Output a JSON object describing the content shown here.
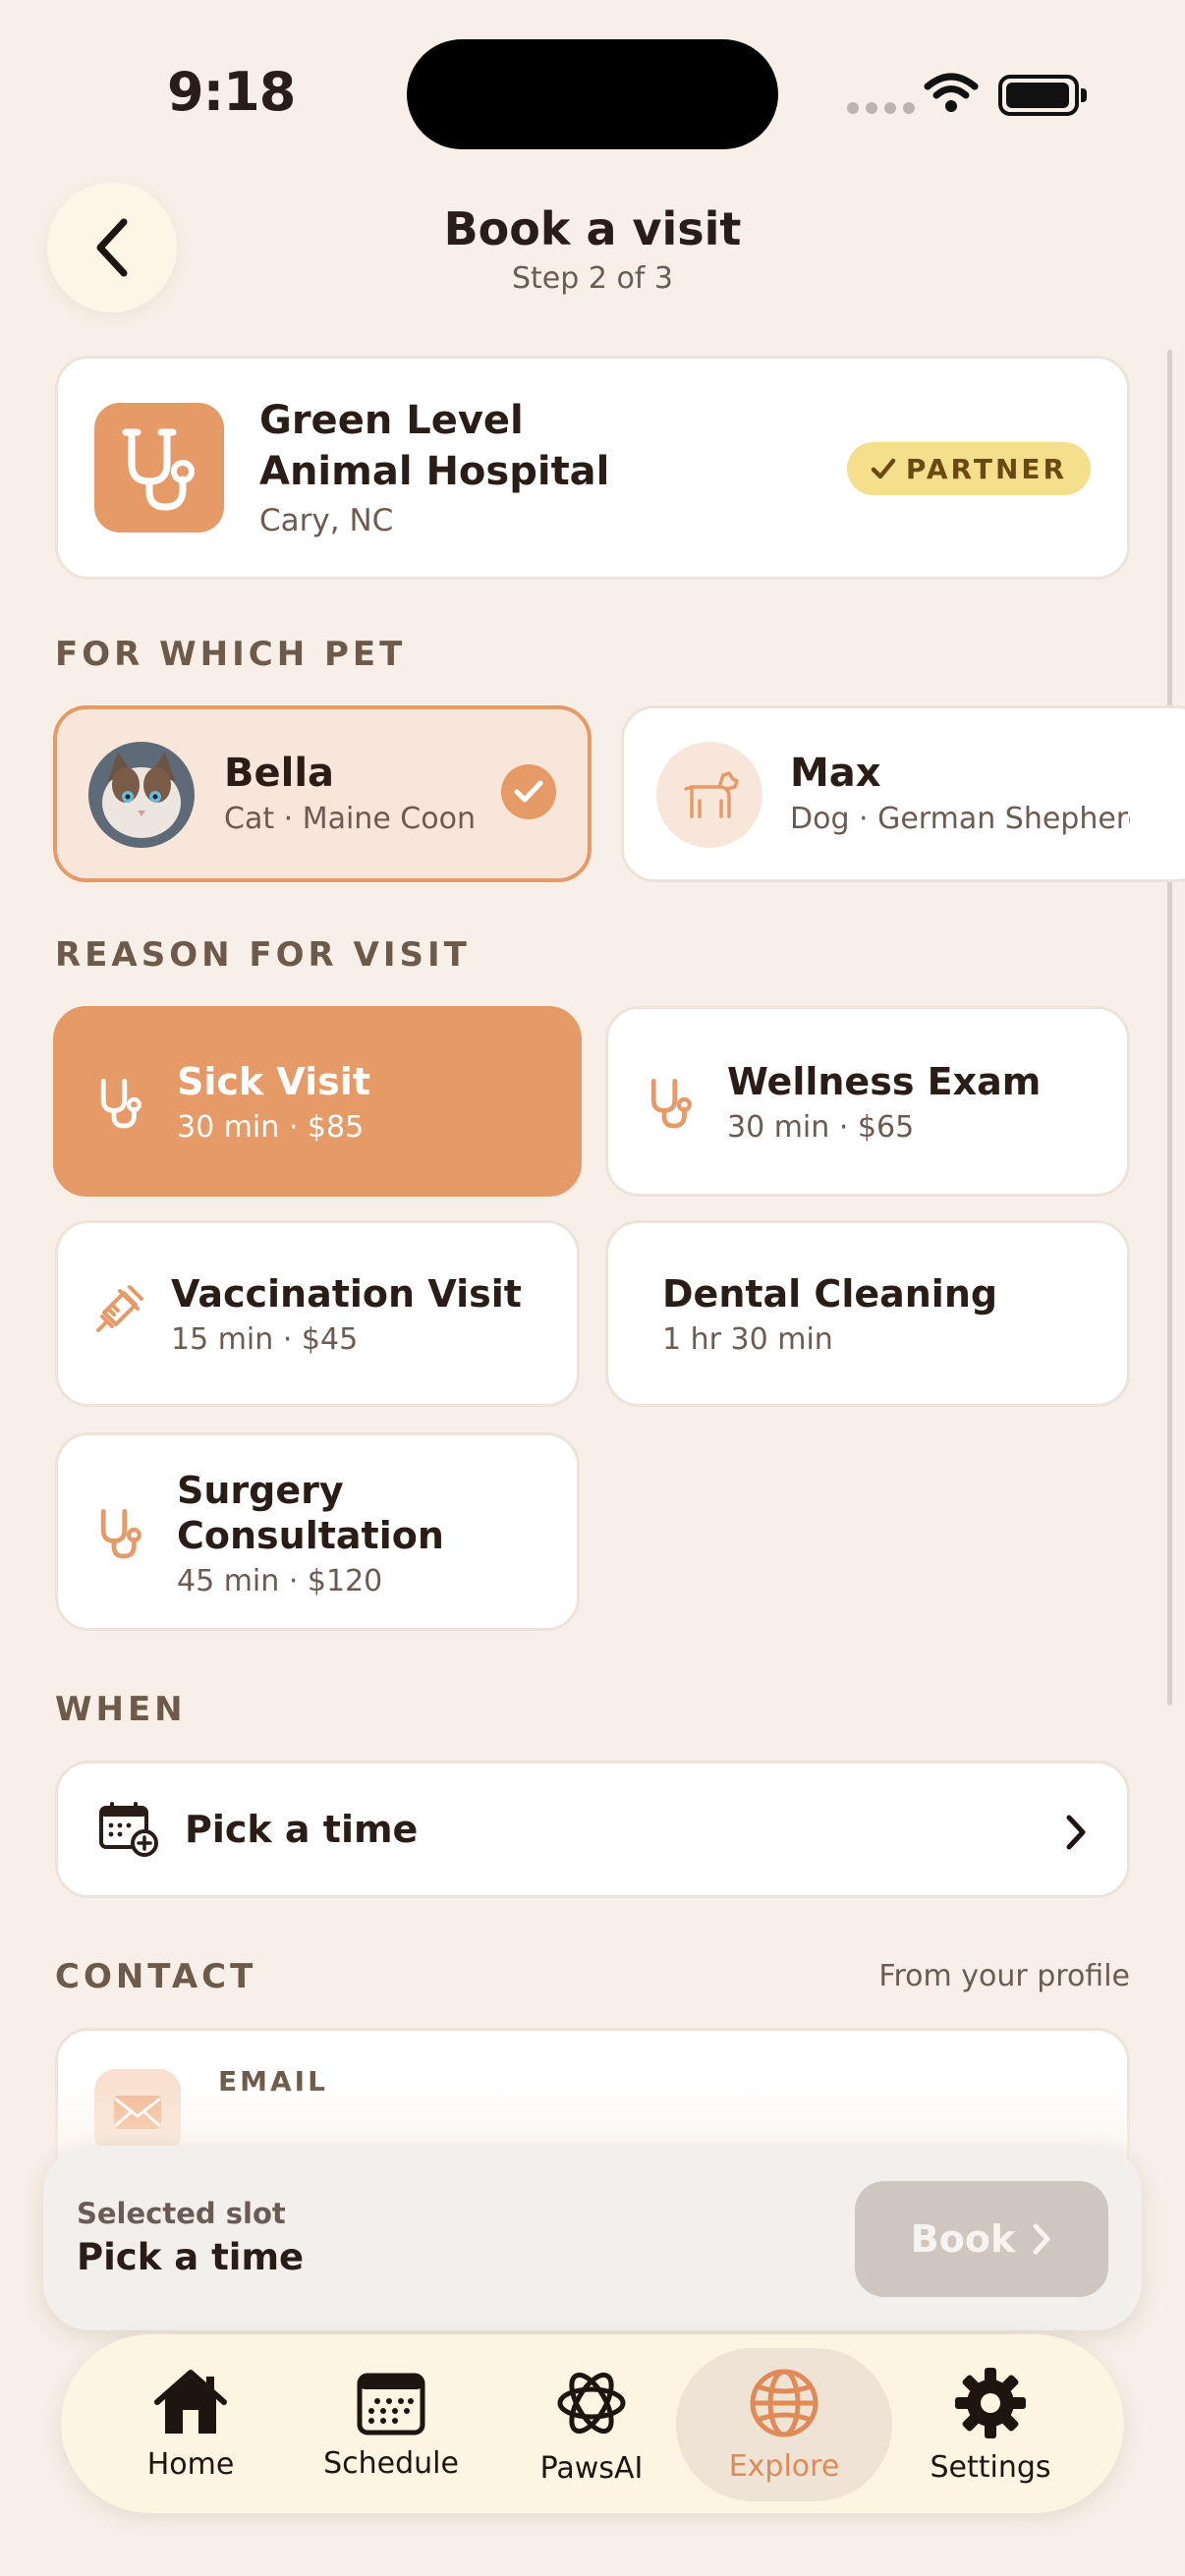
{
  "status_bar": {
    "time": "9:18"
  },
  "header": {
    "title": "Book a visit",
    "step": "Step 2 of 3"
  },
  "clinic": {
    "name": "Green Level Animal Hospital",
    "location": "Cary, NC",
    "badge": "PARTNER"
  },
  "pets": {
    "section_label": "FOR WHICH PET",
    "items": [
      {
        "name": "Bella",
        "description": "Cat · Maine Coon",
        "selected": true
      },
      {
        "name": "Max",
        "description": "Dog · German Shepherd",
        "selected": false
      }
    ]
  },
  "reasons": {
    "section_label": "REASON FOR VISIT",
    "items": [
      {
        "title": "Sick Visit",
        "detail": "30 min · $85",
        "icon": "stethoscope-icon",
        "selected": true
      },
      {
        "title": "Wellness Exam",
        "detail": "30 min · $65",
        "icon": "stethoscope-icon",
        "selected": false
      },
      {
        "title": "Vaccination Visit",
        "detail": "15 min · $45",
        "icon": "syringe-icon",
        "selected": false
      },
      {
        "title": "Dental Cleaning",
        "detail": "1 hr 30 min",
        "icon": "",
        "selected": false
      },
      {
        "title": "Surgery Consultation",
        "detail": "45 min · $120",
        "icon": "stethoscope-icon",
        "selected": false
      }
    ]
  },
  "when": {
    "section_label": "WHEN",
    "pick_label": "Pick a time"
  },
  "contact": {
    "section_label": "CONTACT",
    "note": "From your profile",
    "email_label": "EMAIL"
  },
  "booking_bar": {
    "caption": "Selected slot",
    "value": "Pick a time",
    "button": "Book"
  },
  "tabs": [
    {
      "label": "Home",
      "icon": "house-icon",
      "active": false
    },
    {
      "label": "Schedule",
      "icon": "calendar-icon",
      "active": false
    },
    {
      "label": "PawsAI",
      "icon": "pawsai-icon",
      "active": false
    },
    {
      "label": "Explore",
      "icon": "globe-icon",
      "active": true
    },
    {
      "label": "Settings",
      "icon": "gear-icon",
      "active": false
    }
  ],
  "colors": {
    "background": "#f8f0e8",
    "accent": "#e69a68",
    "text": "#2a1d17",
    "muted": "#6b5b52",
    "badge": "#f6df8c"
  }
}
